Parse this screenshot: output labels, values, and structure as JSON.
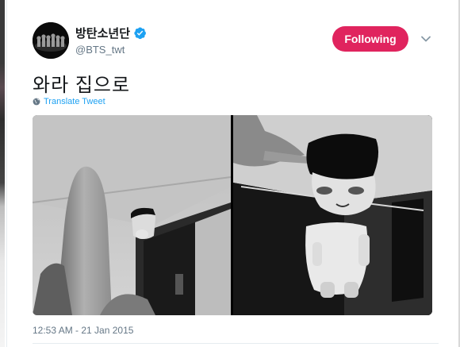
{
  "user": {
    "display_name": "방탄소년단",
    "handle": "@BTS_twt",
    "verified": true
  },
  "actions": {
    "follow_label": "Following"
  },
  "tweet": {
    "text": "와라 집으로",
    "translate_label": "Translate Tweet",
    "timestamp": "12:53 AM - 21 Jan 2015"
  },
  "icons": {
    "verified": "verified-badge-icon",
    "menu": "chevron-down-icon",
    "translate": "globe-icon"
  },
  "colors": {
    "follow_button": "#e0245e",
    "verified_badge": "#1da1f2",
    "link": "#1da1f2",
    "secondary_text": "#657786"
  }
}
